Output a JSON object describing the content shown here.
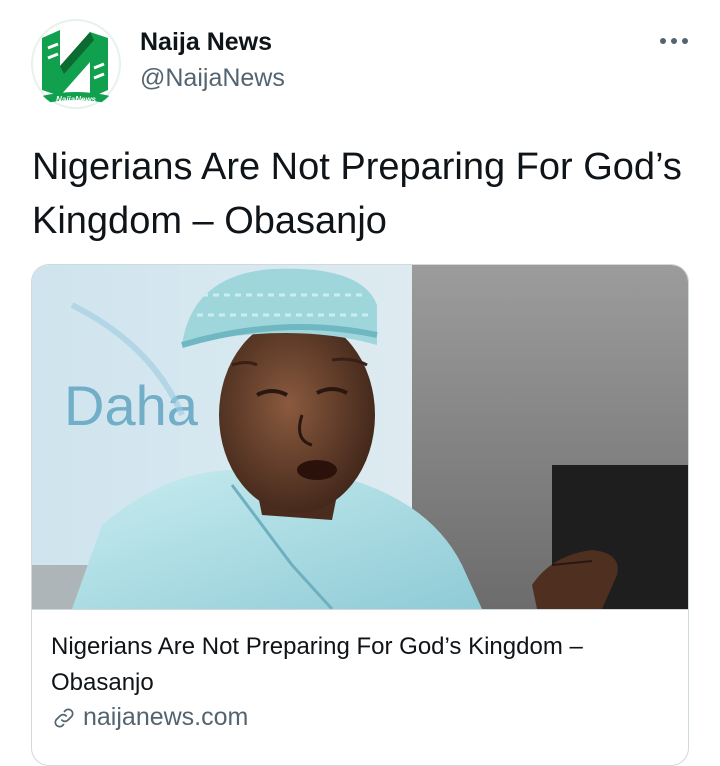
{
  "author": {
    "name": "Naija News",
    "handle": "@NaijaNews",
    "avatar_text": "NaijaNews",
    "avatar_colors": {
      "green": "#0f9d48",
      "dark_green": "#0b6b31",
      "white": "#ffffff"
    }
  },
  "tweet": {
    "text": "Nigerians Are Not Preparing For God’s Kingdom – Obasanjo"
  },
  "card": {
    "image_sign_text": "Daha",
    "title": "Nigerians Are Not Preparing For God’s Kingdom – Obasanjo",
    "domain": "naijanews.com",
    "domain_icon": "link-icon"
  },
  "icons": {
    "more": "more-options-icon"
  }
}
